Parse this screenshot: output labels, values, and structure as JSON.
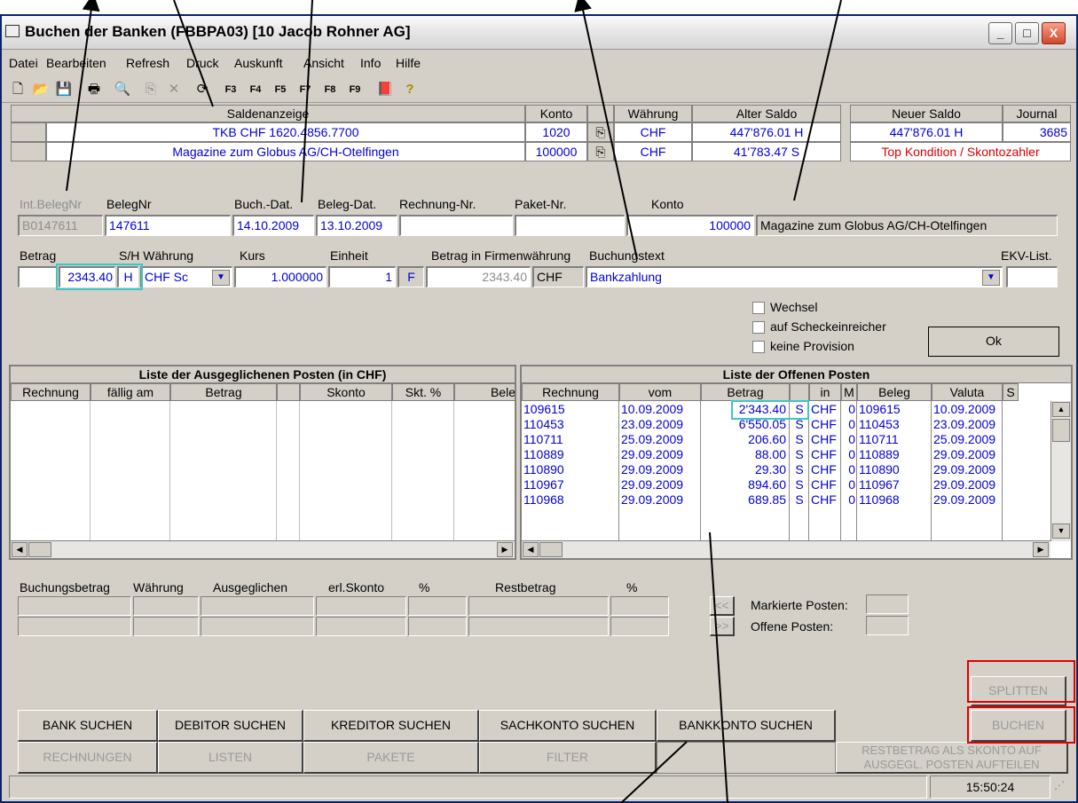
{
  "window": {
    "title": "Buchen der Banken (FBBPA03)    [10 Jacob Rohner AG]",
    "controls": [
      "_",
      "□",
      "X"
    ]
  },
  "menu": [
    "Datei",
    "Bearbeiten",
    "Refresh",
    "Druck",
    "Auskunft",
    "Ansicht",
    "Info",
    "Hilfe"
  ],
  "toolbar": {
    "new": "🗋",
    "open": "📂",
    "save": "💾",
    "print": "🖶",
    "find": "🔍",
    "copy": "⎘",
    "delete": "✕",
    "refresh": "⟳",
    "f3": "F3",
    "f4": "F4",
    "f5": "F5",
    "f7": "F7",
    "f8": "F8",
    "f9": "F9",
    "book": "📕",
    "help": "?"
  },
  "saldo": {
    "headers": {
      "name": "Saldenanzeige",
      "konto": "Konto",
      "waehrung": "Währung",
      "alt": "Alter Saldo",
      "neu": "Neuer Saldo",
      "journal": "Journal"
    },
    "row1": {
      "name": "TKB  CHF 1620.4856.7700",
      "konto": "1020",
      "waehrung": "CHF",
      "alt": "447'876.01 H",
      "neu": "447'876.01 H",
      "journal": "3685"
    },
    "row2": {
      "name": "Magazine zum Globus AG/CH-Otelfingen",
      "konto": "100000",
      "waehrung": "CHF",
      "alt": "41'783.47 S",
      "note": "Top Kondition / Skontozahler"
    }
  },
  "form": {
    "labels": {
      "intbeleg": "Int.BelegNr",
      "belegnr": "BelegNr",
      "buchdat": "Buch.-Dat.",
      "belegdat": "Beleg-Dat.",
      "rechnung": "Rechnung-Nr.",
      "paket": "Paket-Nr.",
      "konto": "Konto",
      "betrag": "Betrag",
      "sh": "S/H Währung",
      "kurs": "Kurs",
      "einheit": "Einheit",
      "firmenw": "Betrag in Firmenwährung",
      "buchungstext": "Buchungstext",
      "ekv": "EKV-List."
    },
    "intbeleg": "B0147611",
    "belegnr": "147611",
    "buchdat": "14.10.2009",
    "belegdat": "13.10.2009",
    "rechnung": "",
    "paket": "",
    "konto_nr": "100000",
    "konto_name": "Magazine zum Globus AG/CH-Otelfingen",
    "betrag": "2343.40",
    "sh": "H",
    "waehrung": "CHF   Sc",
    "kurs": "1.000000",
    "einheit": "1",
    "flag": "F",
    "firmenbetrag": "2343.40",
    "firmenw_cur": "CHF",
    "buchungstext": "Bankzahlung",
    "ekv": ""
  },
  "options": {
    "wechsel": "Wechsel",
    "scheck": "auf Scheckeinreicher",
    "provision": "keine Provision",
    "ok": "Ok"
  },
  "ausgeglichen": {
    "title": "Liste der Ausgeglichenen Posten (in CHF)",
    "columns": [
      "Rechnung",
      "fällig am",
      "Betrag",
      "",
      "Skonto",
      "Skt. %",
      "Bele"
    ]
  },
  "offen": {
    "title": "Liste der Offenen Posten",
    "columns": [
      "Rechnung",
      "vom",
      "Betrag",
      "",
      "in",
      "M",
      "Beleg",
      "Valuta",
      "S"
    ],
    "rows": [
      {
        "rechnung": "109615",
        "vom": "10.09.2009",
        "betrag": "2'343.40",
        "s": "S",
        "in": "CHF",
        "m": "0",
        "beleg": "109615",
        "valuta": "10.09.2009"
      },
      {
        "rechnung": "110453",
        "vom": "23.09.2009",
        "betrag": "6'550.05",
        "s": "S",
        "in": "CHF",
        "m": "0",
        "beleg": "110453",
        "valuta": "23.09.2009"
      },
      {
        "rechnung": "110711",
        "vom": "25.09.2009",
        "betrag": "206.60",
        "s": "S",
        "in": "CHF",
        "m": "0",
        "beleg": "110711",
        "valuta": "25.09.2009"
      },
      {
        "rechnung": "110889",
        "vom": "29.09.2009",
        "betrag": "88.00",
        "s": "S",
        "in": "CHF",
        "m": "0",
        "beleg": "110889",
        "valuta": "29.09.2009"
      },
      {
        "rechnung": "110890",
        "vom": "29.09.2009",
        "betrag": "29.30",
        "s": "S",
        "in": "CHF",
        "m": "0",
        "beleg": "110890",
        "valuta": "29.09.2009"
      },
      {
        "rechnung": "110967",
        "vom": "29.09.2009",
        "betrag": "894.60",
        "s": "S",
        "in": "CHF",
        "m": "0",
        "beleg": "110967",
        "valuta": "29.09.2009"
      },
      {
        "rechnung": "110968",
        "vom": "29.09.2009",
        "betrag": "689.85",
        "s": "S",
        "in": "CHF",
        "m": "0",
        "beleg": "110968",
        "valuta": "29.09.2009"
      }
    ]
  },
  "totals": {
    "labels": [
      "Buchungsbetrag",
      "Währung",
      "Ausgeglichen",
      "erl.Skonto",
      "%",
      "Restbetrag",
      "%"
    ],
    "nav_prev": "<<",
    "nav_next": ">>",
    "markierte": "Markierte Posten:",
    "offene": "Offene Posten:"
  },
  "buttons": {
    "splitten": "SPLITTEN",
    "bank": "BANK SUCHEN",
    "debitor": "DEBITOR SUCHEN",
    "kreditor": "KREDITOR SUCHEN",
    "sachkonto": "SACHKONTO SUCHEN",
    "bankkonto": "BANKKONTO SUCHEN",
    "buchen": "BUCHEN",
    "rechnungen": "RECHNUNGEN",
    "listen": "LISTEN",
    "pakete": "PAKETE",
    "filter": "FILTER",
    "restbetrag1": "RESTBETRAG ALS SKONTO AUF",
    "restbetrag2": "AUSGEGL. POSTEN AUFTEILEN"
  },
  "status": {
    "time": "15:50:24"
  },
  "colors": {
    "highlight_cyan": "#38c8c8",
    "highlight_red": "#e00000",
    "value_blue": "#0000d8",
    "note_red": "#e00000"
  }
}
